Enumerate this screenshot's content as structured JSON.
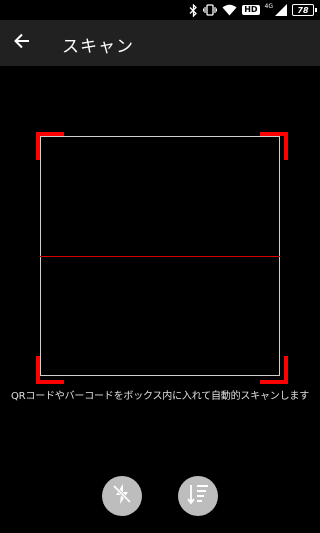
{
  "status_bar": {
    "hd_label": "HD",
    "network_label": "4G",
    "battery_level": "78",
    "icons": [
      "bluetooth-icon",
      "vibrate-icon",
      "wifi-icon",
      "hd-icon",
      "signal-icon",
      "battery-icon"
    ]
  },
  "app_bar": {
    "back_icon": "arrow-back-icon",
    "title": "スキャン"
  },
  "scanner": {
    "frame_color": "#cfcfcf",
    "corner_color": "#ff0000",
    "laser_color": "#d50000",
    "hint": "QRコードやバーコードをボックス内に入れて自動的スキャンします"
  },
  "controls": {
    "flash_icon": "flash-off-icon",
    "sort_icon": "sort-descending-icon"
  }
}
